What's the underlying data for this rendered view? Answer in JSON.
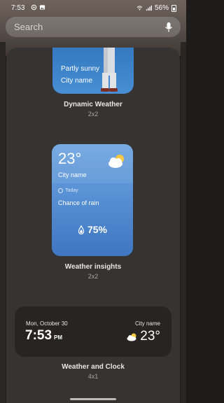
{
  "status_bar": {
    "time": "7:53",
    "battery": "56%"
  },
  "search": {
    "placeholder": "Search"
  },
  "widgets": [
    {
      "name": "Dynamic Weather",
      "size": "2x2",
      "lines": [
        "Partly sunny",
        "City name"
      ]
    },
    {
      "name": "Weather insights",
      "size": "2x2",
      "temp": "23°",
      "city": "City name",
      "today": "Today",
      "chance_label": "Chance of rain",
      "chance_value": "75%"
    },
    {
      "name": "Weather and Clock",
      "size": "4x1",
      "date": "Mon, October 30",
      "time": "7:53",
      "ampm": "PM",
      "city": "City name",
      "temp": "23°"
    }
  ]
}
